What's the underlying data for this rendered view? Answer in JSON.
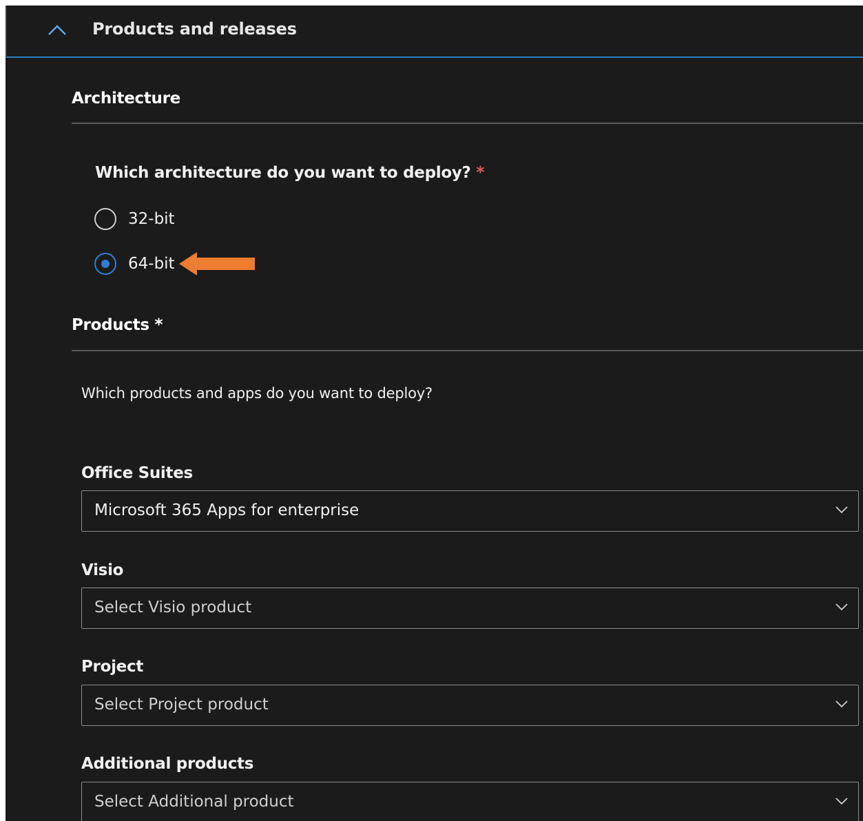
{
  "accordion": {
    "title": "Products and releases",
    "expanded_icon": "chevron-up-icon",
    "accent_color": "#2b7fc3"
  },
  "architecture": {
    "section_title": "Architecture",
    "question": "Which architecture do you want to deploy?",
    "required_marker": "*",
    "options": [
      {
        "label": "32-bit",
        "selected": false
      },
      {
        "label": "64-bit",
        "selected": true
      }
    ],
    "annotation": "orange-arrow-pointing-left",
    "annotation_color": "#ed7d31"
  },
  "products": {
    "section_title": "Products *",
    "question": "Which products and apps do you want to deploy?",
    "fields": [
      {
        "label": "Office Suites",
        "value": "Microsoft 365 Apps for enterprise",
        "is_placeholder": false
      },
      {
        "label": "Visio",
        "value": "Select Visio product",
        "is_placeholder": true
      },
      {
        "label": "Project",
        "value": "Select Project product",
        "is_placeholder": true
      },
      {
        "label": "Additional products",
        "value": "Select Additional product",
        "is_placeholder": true
      }
    ],
    "dropdown_icon": "chevron-down-icon"
  },
  "theme": {
    "background": "#1b1b1b",
    "text": "#f0f0f0",
    "radio_selected": "#2b7fd6",
    "required_star": "#e05a5a"
  }
}
